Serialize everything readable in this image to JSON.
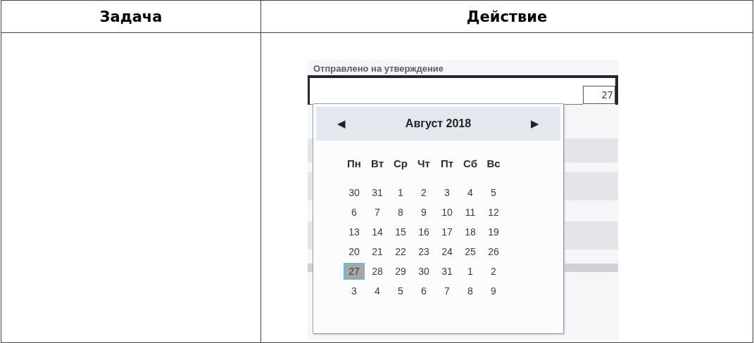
{
  "table": {
    "columns": [
      "Задача",
      "Действие"
    ],
    "rows": [
      {
        "task": "",
        "action": {
          "kind": "picture-screenshot",
          "form": {
            "title": "Отправлено на утверждение",
            "date_button": "27",
            "calendar": {
              "month": "Август 2018",
              "prev": "◀",
              "next": "▶",
              "weekdays": [
                "Пн",
                "Вт",
                "Ср",
                "Чт",
                "Пт",
                "Сб",
                "Вс"
              ],
              "weeks": [
                [
                  {
                    "day": "30",
                    "selected": false
                  },
                  {
                    "day": "31",
                    "selected": false
                  },
                  {
                    "day": "1",
                    "selected": false
                  },
                  {
                    "day": "2",
                    "selected": false
                  },
                  {
                    "day": "3",
                    "selected": false
                  },
                  {
                    "day": "4",
                    "selected": false
                  },
                  {
                    "day": "5",
                    "selected": false
                  }
                ],
                [
                  {
                    "day": "6",
                    "selected": false
                  },
                  {
                    "day": "7",
                    "selected": false
                  },
                  {
                    "day": "8",
                    "selected": false
                  },
                  {
                    "day": "9",
                    "selected": false
                  },
                  {
                    "day": "10",
                    "selected": false
                  },
                  {
                    "day": "11",
                    "selected": false
                  },
                  {
                    "day": "12",
                    "selected": false
                  }
                ],
                [
                  {
                    "day": "13",
                    "selected": false
                  },
                  {
                    "day": "14",
                    "selected": false
                  },
                  {
                    "day": "15",
                    "selected": false
                  },
                  {
                    "day": "16",
                    "selected": false
                  },
                  {
                    "day": "17",
                    "selected": false
                  },
                  {
                    "day": "18",
                    "selected": false
                  },
                  {
                    "day": "19",
                    "selected": false
                  }
                ],
                [
                  {
                    "day": "20",
                    "selected": false
                  },
                  {
                    "day": "21",
                    "selected": false
                  },
                  {
                    "day": "22",
                    "selected": false
                  },
                  {
                    "day": "23",
                    "selected": false
                  },
                  {
                    "day": "24",
                    "selected": false
                  },
                  {
                    "day": "25",
                    "selected": false
                  },
                  {
                    "day": "26",
                    "selected": false
                  }
                ],
                [
                  {
                    "day": "27",
                    "selected": true
                  },
                  {
                    "day": "28",
                    "selected": false
                  },
                  {
                    "day": "29",
                    "selected": false
                  },
                  {
                    "day": "30",
                    "selected": false
                  },
                  {
                    "day": "31",
                    "selected": false
                  },
                  {
                    "day": "1",
                    "selected": false
                  },
                  {
                    "day": "2",
                    "selected": false
                  }
                ],
                [
                  {
                    "day": "3",
                    "selected": false
                  },
                  {
                    "day": "4",
                    "selected": false
                  },
                  {
                    "day": "5",
                    "selected": false
                  },
                  {
                    "day": "6",
                    "selected": false
                  },
                  {
                    "day": "7",
                    "selected": false
                  },
                  {
                    "day": "8",
                    "selected": false
                  },
                  {
                    "day": "9",
                    "selected": false
                  }
                ]
              ]
            }
          }
        }
      }
    ]
  }
}
